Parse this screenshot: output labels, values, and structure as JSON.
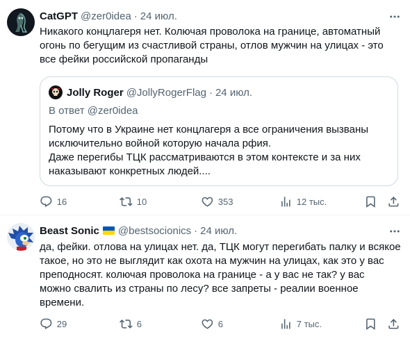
{
  "tweets": [
    {
      "author_name": "CatGPT",
      "handle": "@zer0idea",
      "separator": "·",
      "date": "24 июл.",
      "text_lines": [
        "Никакого концлагеря нет. Колючая проволока на границе, автоматный",
        "огонь по бегущим из счастливой страны, отлов мужчин на улицах - это",
        "все фейки российской пропаганды"
      ],
      "quote": {
        "author_name": "Jolly Roger",
        "handle": "@JollyRogerFlag",
        "separator": "·",
        "date": "24 июл.",
        "reply_prefix": "В ответ",
        "reply_mention": "@zer0idea",
        "text_lines": [
          "Потому что в Украине нет концлагеря а все ограничения вызваны",
          "исключительно войной которую начала рфия.",
          "Даже перегибы ТЦК рассматриваются в этом контексте и за них",
          "наказывают конкретных людей...."
        ]
      },
      "actions": {
        "replies": "16",
        "reposts": "10",
        "likes": "353",
        "views": "12 тыс."
      }
    },
    {
      "author_name": "Beast Sonic",
      "handle": "@bestsocionics",
      "separator": "·",
      "date": "24 июл.",
      "text_lines": [
        "да, фейки. отлова на улицах нет. да, ТЦК могут перегибать палку и всякое",
        "такое, но это не выглядит как охота на мужчин на улицах, как это у вас",
        "преподносят. колючая проволока на границе - а у вас не так? у вас",
        "можно свалить из страны по лесу? все запреты - реалии военное",
        "времени."
      ],
      "actions": {
        "replies": "29",
        "reposts": "6",
        "likes": "6",
        "views": "7 тыс."
      }
    }
  ],
  "icons": {
    "more": "more-horizontal-icon",
    "reply": "reply-bubble-icon",
    "repost": "repost-arrows-icon",
    "like": "heart-icon",
    "views": "views-bar-chart-icon",
    "bookmark": "bookmark-icon",
    "share": "share-upload-icon"
  },
  "colors": {
    "text": "#0f1419",
    "secondary": "#536471",
    "border": "#cfd9de",
    "flag_blue": "#0057b7",
    "flag_yellow": "#ffd700"
  }
}
